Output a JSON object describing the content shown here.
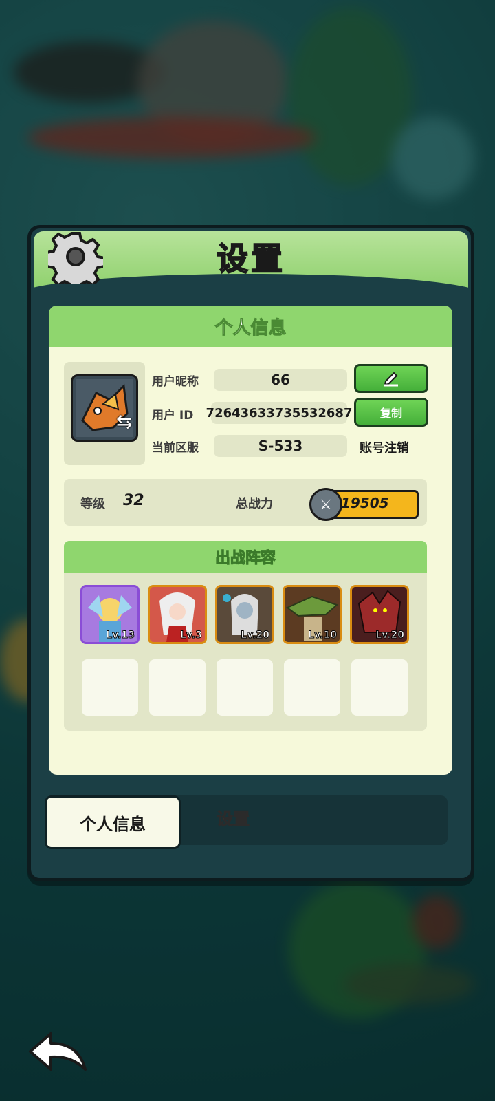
{
  "panel": {
    "title": "设置"
  },
  "profile": {
    "section_title": "个人信息",
    "nickname_label": "用户昵称",
    "nickname": "66",
    "edit_icon": "pencil-icon",
    "id_label": "用户 ID",
    "user_id": "72643633735532687",
    "copy_label": "复制",
    "server_label": "当前区服",
    "server": "S-533",
    "delete_account_label": "账号注销"
  },
  "stats": {
    "level_label": "等级",
    "level": "32",
    "power_label": "总战力",
    "power": "19505"
  },
  "team": {
    "title": "出战阵容",
    "heroes": [
      {
        "level": "Lv.13",
        "color": "#a77ae0"
      },
      {
        "level": "Lv.3",
        "color": "#d4584a"
      },
      {
        "level": "Lv.20",
        "color": "#6a6a6a"
      },
      {
        "level": "Lv.10",
        "color": "#8c6b3a"
      },
      {
        "level": "Lv.20",
        "color": "#8a2c2c"
      }
    ]
  },
  "tabs": {
    "active": "个人信息",
    "inactive": "设置"
  }
}
